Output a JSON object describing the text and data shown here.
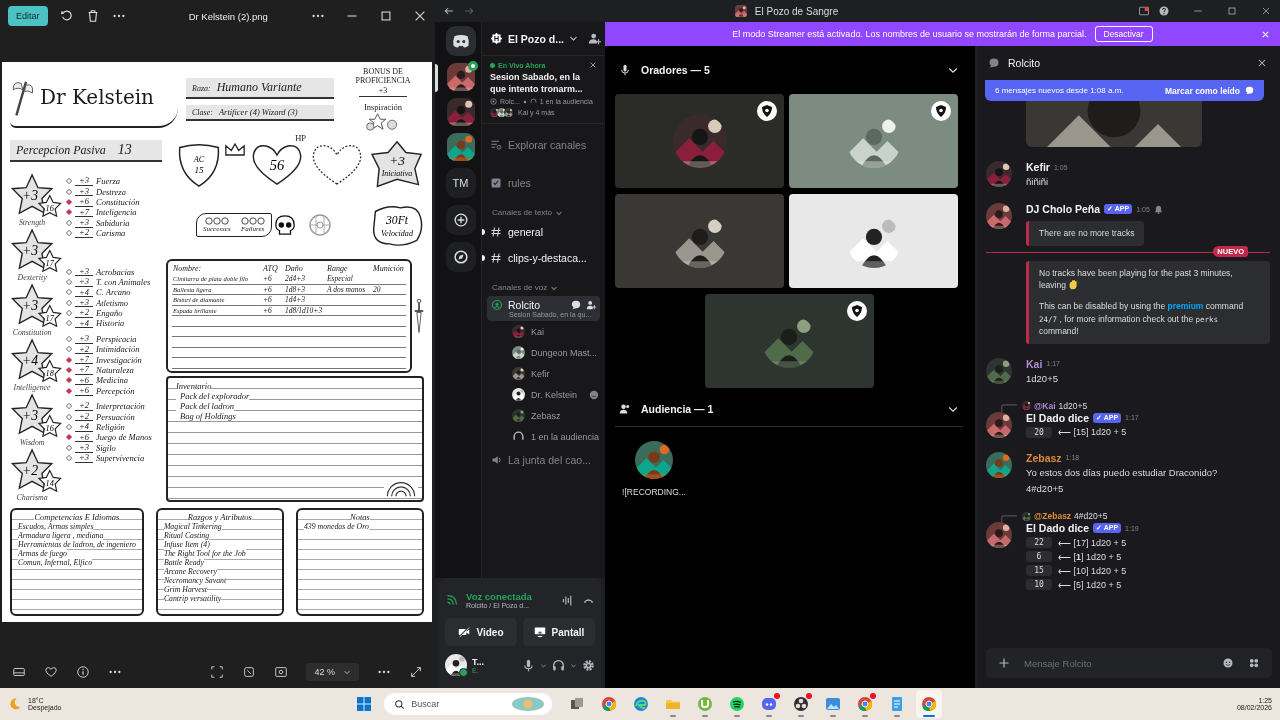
{
  "viewer": {
    "edit_button": "Editar",
    "file_title": "Dr Kelstein (2).png",
    "zoom": "42 %",
    "sheet": {
      "character_name": "Dr Kelstein",
      "race_label": "Raza:",
      "race": "Humano Variante",
      "class_label": "Clase:",
      "class": "Artificer (4) Wizard (3)",
      "proficiency_label": "BONUS DE PROFICIENCIA",
      "proficiency": "+3",
      "inspiration_label": "Inspiración",
      "passive_perception_label": "Percepcion Pasiva",
      "passive_perception": "13",
      "abilities": [
        {
          "modifier": "+3",
          "score": "16",
          "label": "Strength"
        },
        {
          "modifier": "+3",
          "score": "17",
          "label": "Dexterity"
        },
        {
          "modifier": "+3",
          "score": "17",
          "label": "Constitution"
        },
        {
          "modifier": "+4",
          "score": "18",
          "label": "Intelligence"
        },
        {
          "modifier": "+3",
          "score": "16",
          "label": "Wisdom"
        },
        {
          "modifier": "+2",
          "score": "14",
          "label": "Charisma"
        }
      ],
      "saves": [
        {
          "bonus": "+3",
          "name": "Fuerza",
          "proficient": false
        },
        {
          "bonus": "+3",
          "name": "Destreza",
          "proficient": false
        },
        {
          "bonus": "+6",
          "name": "Constitución",
          "proficient": true
        },
        {
          "bonus": "+7",
          "name": "Inteligencia",
          "proficient": true
        },
        {
          "bonus": "+3",
          "name": "Sabiduria",
          "proficient": false
        },
        {
          "bonus": "+2",
          "name": "Carisma",
          "proficient": false
        }
      ],
      "skills": [
        {
          "bonus": "+3",
          "name": "Acrobacias",
          "proficient": false
        },
        {
          "bonus": "+3",
          "name": "T. con Animales",
          "proficient": false
        },
        {
          "bonus": "+4",
          "name": "C. Arcano",
          "proficient": false
        },
        {
          "bonus": "+3",
          "name": "Atletismo",
          "proficient": false
        },
        {
          "bonus": "+2",
          "name": "Engaño",
          "proficient": false
        },
        {
          "bonus": "+4",
          "name": "Historia",
          "proficient": false
        },
        {
          "bonus": "+3",
          "name": "Perspicacia",
          "proficient": false
        },
        {
          "bonus": "+2",
          "name": "Intimidación",
          "proficient": false
        },
        {
          "bonus": "+7",
          "name": "Investigación",
          "proficient": true
        },
        {
          "bonus": "+7",
          "name": "Naturaleza",
          "proficient": true
        },
        {
          "bonus": "+6",
          "name": "Medicina",
          "proficient": true
        },
        {
          "bonus": "+6",
          "name": "Percepción",
          "proficient": true
        },
        {
          "bonus": "+2",
          "name": "Interpretación",
          "proficient": false
        },
        {
          "bonus": "+2",
          "name": "Persuación",
          "proficient": false
        },
        {
          "bonus": "+4",
          "name": "Religión",
          "proficient": false
        },
        {
          "bonus": "+6",
          "name": "Juego de Manos",
          "proficient": true
        },
        {
          "bonus": "+3",
          "name": "Sigilo",
          "proficient": false
        },
        {
          "bonus": "+3",
          "name": "Supervivencia",
          "proficient": false
        }
      ],
      "armor_class_label": "AC",
      "armor_class": "15",
      "hp_label": "HP",
      "hp": "56",
      "initiative": "+3",
      "initiative_label": "Iniciativa",
      "speed": "30Ft",
      "speed_label": "Velocidad",
      "death_saves": [
        "Successes",
        "Failures"
      ],
      "attacks": {
        "columns": [
          "Nombre:",
          "ATQ",
          "Daño",
          "Range",
          "Munición"
        ],
        "rows": [
          {
            "name": "Cimitarra de plata doble filo",
            "attack": "+6",
            "damage": "2d4+3",
            "range": "Especial"
          },
          {
            "name": "Ballesta ligera",
            "attack": "+6",
            "damage": "1d8+3",
            "range": "A dos manos",
            "ammo": "20"
          },
          {
            "name": "Bisturi de diamante",
            "attack": "+6",
            "damage": "1d4+3"
          },
          {
            "name": "Espada brillante",
            "attack": "+6",
            "damage": "1d8/1d10+3"
          }
        ]
      },
      "inventory": {
        "title": "Inventario",
        "items": [
          "Pack del explorador",
          "Pack del ladron",
          "Bag of Holdings"
        ]
      },
      "boxes": [
        {
          "title": "Competencias E Idiomas",
          "lines": [
            "Escudos, Armas simples",
            "Armadura ligera , mediana",
            "Herramientas de ladron, de ingeniero",
            "Armas de fuego",
            "Comun, Infernal, Elfico"
          ]
        },
        {
          "title": "Razgos y Atributos",
          "lines": [
            "Magical Tinkering",
            "Ritual Casting",
            "Infuse Item (4)",
            "The Right Tool for the Job",
            "Battle Ready",
            "Arcane Recovery",
            "Necromancy Savant",
            "Grim Harvest",
            "Cantrip versatility"
          ]
        },
        {
          "title": "Notas",
          "lines": [
            "439 monedas de Oro"
          ]
        }
      ]
    }
  },
  "discord": {
    "window_title": "El Pozo de Sangre",
    "streamer_banner": {
      "text": "El modo Streamer está activado. Los nombres de usuario se mostrarán de forma parcial.",
      "button": "Desactivar"
    },
    "servers": [
      {
        "kind": "picture",
        "selected": true,
        "live": true
      },
      {
        "kind": "picture",
        "selected": false,
        "live": false
      },
      {
        "kind": "picture",
        "selected": false,
        "live": false
      },
      {
        "kind": "text",
        "label": "TM",
        "selected": false,
        "live": false
      },
      {
        "kind": "add",
        "selected": false,
        "live": false
      },
      {
        "kind": "discover",
        "selected": false,
        "live": false
      }
    ],
    "server_name": "El Pozo d...",
    "live_event": {
      "status": "En Vivo Ahora",
      "title": "Sesion Sabado, en la que intento tronarm...",
      "host": "Rolc...",
      "audience": "1 en la audiencia",
      "participants": "Kai y 4 más"
    },
    "channels": [
      {
        "kind": "browse",
        "name": "Explorar canales"
      },
      {
        "kind": "rules",
        "name": "rules"
      }
    ],
    "text_category": "Canales de texto",
    "text_channels": [
      {
        "name": "general",
        "unread": true
      },
      {
        "name": "clips-y-destaca...",
        "unread": true
      }
    ],
    "voice_category": "Canales de voz",
    "voice_channels": [
      {
        "kind": "stage",
        "name": "Rolcito",
        "topic": "Sesion Sabado, en la qu...",
        "selected": true,
        "audience": "1 en la audiencia",
        "members": [
          {
            "name": "Kai",
            "activity": false
          },
          {
            "name": "Dungeon Mast...",
            "activity": false
          },
          {
            "name": "Kefir",
            "activity": false
          },
          {
            "name": "Dr. Kelstein",
            "activity": true
          },
          {
            "name": "Zebasz",
            "activity": false
          }
        ]
      },
      {
        "kind": "voice",
        "name": "La junta del cao...",
        "selected": false
      }
    ],
    "voice_panel": {
      "status": "Voz conectada",
      "location": "Rolcito / El Pozo d...",
      "buttons": [
        "Video",
        "Pantall"
      ]
    },
    "user": {
      "name": "T...",
      "status": "E."
    },
    "stage": {
      "speakers_label": "Oradores — 5",
      "speakers": [
        {
          "moderator": true
        },
        {
          "moderator": true
        },
        {
          "moderator": false
        },
        {
          "moderator": false
        },
        {
          "moderator": true
        }
      ],
      "audience_label": "Audiencia — 1",
      "audience": [
        {
          "name": "![RECORDING..."
        }
      ]
    },
    "chat": {
      "channel": "Rolcito",
      "new_messages": "6 mensajes nuevos desde 1:08 a.m.",
      "mark_read": "Marcar como leído",
      "attachment": {
        "kind": "picture"
      },
      "messages": [
        {
          "kind": "user",
          "author": "Kefir",
          "color": "#f2f3f5",
          "time": "1:05",
          "lines": [
            "ñiñiñi"
          ]
        },
        {
          "kind": "bot",
          "author": "DJ Cholo Peña",
          "color": "#f2f3f5",
          "tag": "✓ APP",
          "time": "1:05",
          "notification_icon": true,
          "embed": [
            [
              {
                "kind": "text",
                "text": "There are no more tracks"
              }
            ]
          ]
        },
        {
          "kind": "divider",
          "label": "NUEVO"
        },
        {
          "kind": "continuation",
          "embed": [
            [
              {
                "kind": "text",
                "text": "No tracks have been playing for the past 3 minutes, leaving"
              },
              {
                "kind": "emoji"
              }
            ],
            [
              {
                "kind": "text",
                "text": "This can be disabled by using the "
              },
              {
                "kind": "link",
                "text": "premium"
              },
              {
                "kind": "text",
                "text": " command "
              },
              {
                "kind": "code",
                "text": "24/7"
              },
              {
                "kind": "text",
                "text": " , for more information check out the "
              },
              {
                "kind": "code",
                "text": "perks"
              },
              {
                "kind": "text",
                "text": " command!"
              }
            ]
          ]
        },
        {
          "kind": "user",
          "author": "Kai",
          "color": "#b28ad6",
          "time": "1:17",
          "lines": [
            "1d20+5"
          ]
        },
        {
          "kind": "bot",
          "author": "El Dado dice",
          "color": "#f2f3f5",
          "tag": "✓ APP",
          "time": "1:17",
          "notification_icon": false,
          "reply": {
            "mention": "@Kai",
            "color": "#b28ad6",
            "text": "1d20+5"
          },
          "rolls": [
            {
              "total": "20",
              "detail": "⟵ [15] 1d20 + 5"
            }
          ]
        },
        {
          "kind": "user",
          "author": "Zebasz",
          "color": "#e08a3c",
          "time": "1:18",
          "lines": [
            "Yo estos dos días puedo estudiar Draconido?",
            "4#d20+5"
          ]
        },
        {
          "kind": "bot",
          "author": "El Dado dice",
          "color": "#f2f3f5",
          "tag": "✓ APP",
          "time": "1:19",
          "notification_icon": false,
          "reply": {
            "mention": "@Zebasz",
            "color": "#e08a3c",
            "text": "4#d20+5"
          },
          "rolls": [
            {
              "total": "22",
              "detail": "⟵ [17] 1d20 + 5"
            },
            {
              "total": "6",
              "detail": "⟵ [**1**] 1d20 + 5"
            },
            {
              "total": "15",
              "detail": "⟵ [10] 1d20 + 5"
            },
            {
              "total": "10",
              "detail": "⟵ [5] 1d20 + 5"
            }
          ]
        }
      ],
      "placeholder": "Mensaje Rolcito"
    }
  },
  "taskbar": {
    "weather": {
      "temp": "18°C",
      "condition": "Despejado"
    },
    "search_placeholder": "Buscar",
    "apps": [
      {
        "kind": "taskview",
        "open": false,
        "badge": false,
        "selected": false
      },
      {
        "kind": "chrome",
        "open": false,
        "badge": false,
        "selected": false
      },
      {
        "kind": "edge",
        "open": false,
        "badge": false,
        "selected": false
      },
      {
        "kind": "folder",
        "open": true,
        "badge": false,
        "selected": false
      },
      {
        "kind": "torrent",
        "open": true,
        "badge": false,
        "selected": false
      },
      {
        "kind": "spotify",
        "open": true,
        "badge": false,
        "selected": false
      },
      {
        "kind": "discord",
        "open": true,
        "badge": true,
        "selected": false
      },
      {
        "kind": "obs",
        "open": true,
        "badge": true,
        "selected": false
      },
      {
        "kind": "photos",
        "open": true,
        "badge": false,
        "selected": false
      },
      {
        "kind": "chrome",
        "open": true,
        "badge": true,
        "selected": false
      },
      {
        "kind": "notepad",
        "open": true,
        "badge": false,
        "selected": false
      },
      {
        "kind": "chrome",
        "open": true,
        "badge": false,
        "selected": true
      }
    ],
    "time": "1:25",
    "date": "08/02/2026"
  }
}
